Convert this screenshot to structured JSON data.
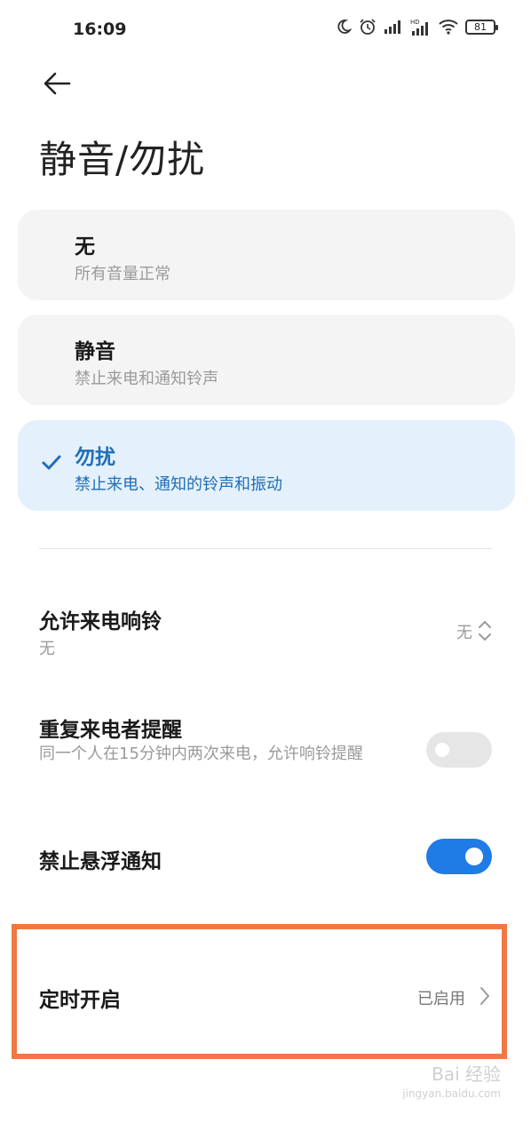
{
  "status_bar": {
    "time": "16:09",
    "battery": "81",
    "icons": [
      "moon-icon",
      "alarm-icon",
      "signal-icon",
      "hd-signal-icon",
      "wifi-icon",
      "battery-icon"
    ]
  },
  "header": {
    "back_icon": "arrow-left-icon",
    "title": "静音/勿扰"
  },
  "modes": [
    {
      "title": "无",
      "subtitle": "所有音量正常",
      "selected": false
    },
    {
      "title": "静音",
      "subtitle": "禁止来电和通知铃声",
      "selected": false
    },
    {
      "title": "勿扰",
      "subtitle": "禁止来电、通知的铃声和振动",
      "selected": true
    }
  ],
  "settings": {
    "allow_calls": {
      "title": "允许来电响铃",
      "subtitle": "无",
      "value": "无"
    },
    "repeat_callers": {
      "title": "重复来电者提醒",
      "subtitle": "同一个人在15分钟内两次来电，允许响铃提醒",
      "enabled": false
    },
    "block_floating": {
      "title": "禁止悬浮通知",
      "enabled": true
    },
    "schedule": {
      "title": "定时开启",
      "value": "已启用"
    }
  },
  "colors": {
    "accent": "#1f7be6",
    "selected_bg": "#e4f0fb",
    "highlight_border": "#f07843"
  },
  "watermark": {
    "main": "Bai 经验",
    "sub": "jingyan.baidu.com"
  }
}
